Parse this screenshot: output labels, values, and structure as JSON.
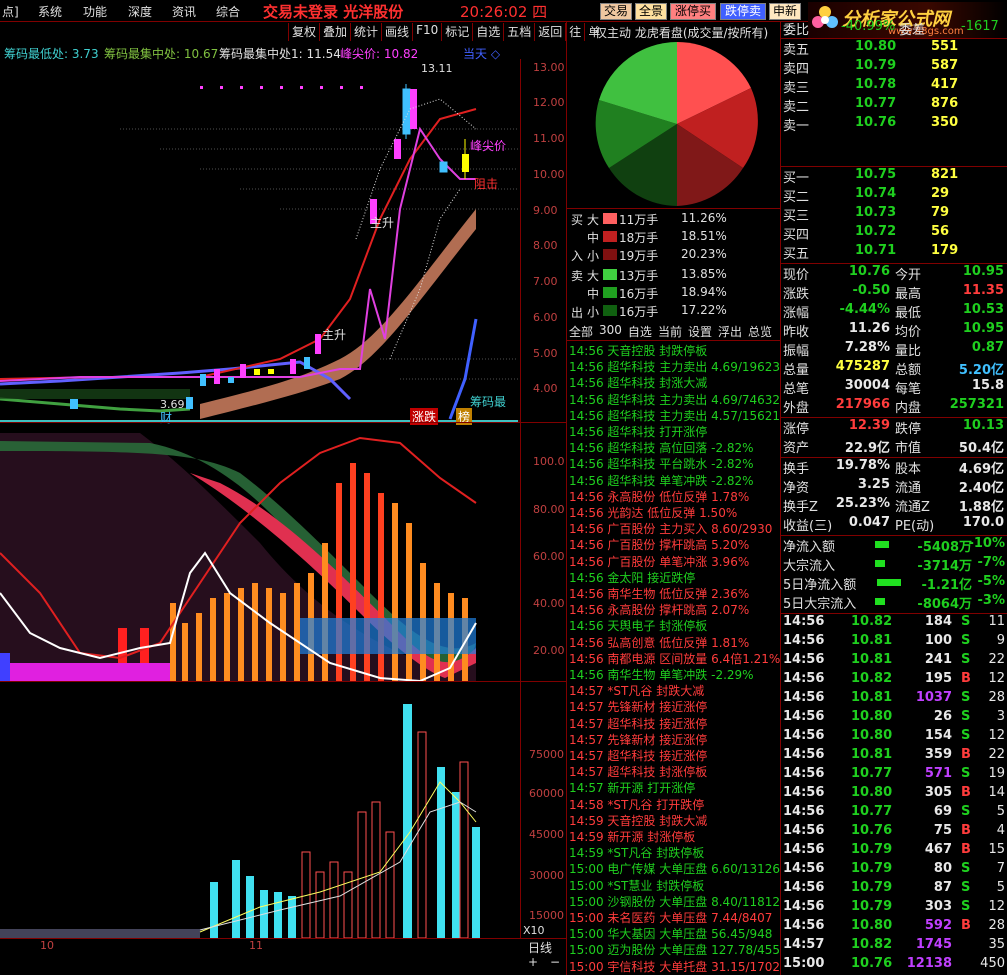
{
  "topbar": {
    "menu": [
      "点]",
      "系统",
      "功能",
      "深度",
      "资讯",
      "综合"
    ],
    "title": "交易未登录  光洋股份",
    "time": "20:26:02 四",
    "buttons": [
      "交易",
      "全景",
      "涨停买",
      "跌停卖",
      "申新"
    ],
    "brand": "分析家公式网",
    "brand_url": "www.88gs.com"
  },
  "chart_labels": {
    "chip_low": "筹码最低处: 3.73",
    "chip_mid": "筹码最集中处: 10.67",
    "chip_peak": "筹码最集中处1: 11.54",
    "peak_price": "峰尖价: 10.82",
    "today": "当天 ◇",
    "toolbar": [
      "复权",
      "叠加",
      "统计",
      "画线",
      "F10",
      "标记",
      "自选",
      "五档",
      "返回",
      "往",
      "单"
    ],
    "annot_zhusheng": "主升",
    "annot_zhusheng2": "主升",
    "annot_zuji": "阻击",
    "annot_fengjian": "峰尖价",
    "annot_chou": "筹码最",
    "annot_high": "13.11",
    "annot_low": "3.69",
    "annot_cai": "财",
    "annot_zhangdie": "涨跌",
    "annot_bang": "榜",
    "annot_x10": "X10",
    "annot_rixian": "日线",
    "annot_month10": "10",
    "annot_month11": "11",
    "plus": "+",
    "minus": "−"
  },
  "price_axis": [
    "13.00",
    "12.00",
    "11.00",
    "10.00",
    "9.00",
    "8.00",
    "7.00",
    "6.00",
    "5.00",
    "4.00"
  ],
  "osc_axis": [
    "100.0",
    "80.00",
    "60.00",
    "40.00",
    "20.00"
  ],
  "vol_axis": [
    "75000",
    "60000",
    "45000",
    "30000",
    "15000"
  ],
  "pie_header": "仅主动 龙虎看盘(成交量/按所有)",
  "flow": {
    "buy_label": [
      "买",
      "入"
    ],
    "sell_label": [
      "卖",
      "出"
    ],
    "rows": [
      {
        "side": "大",
        "vol": "11万手",
        "pct": "11.26%",
        "color": "#ff6060"
      },
      {
        "side": "中",
        "vol": "18万手",
        "pct": "18.51%",
        "color": "#c02020"
      },
      {
        "side": "小",
        "vol": "19万手",
        "pct": "20.23%",
        "color": "#801010"
      },
      {
        "side": "大",
        "vol": "13万手",
        "pct": "13.85%",
        "color": "#40d040"
      },
      {
        "side": "中",
        "vol": "16万手",
        "pct": "18.94%",
        "color": "#20a020"
      },
      {
        "side": "小",
        "vol": "16万手",
        "pct": "17.22%",
        "color": "#106010"
      }
    ],
    "tabs": [
      "全部",
      "300",
      "自选",
      "当前",
      "设置",
      "浮出",
      "总览"
    ]
  },
  "news": [
    {
      "t": "14:56",
      "n": "天音控股",
      "e": "封跌停板",
      "v": "",
      "c": "grn"
    },
    {
      "t": "14:56",
      "n": "超华科技",
      "e": "主力卖出",
      "v": "4.69/19623",
      "c": "grn"
    },
    {
      "t": "14:56",
      "n": "超华科技",
      "e": "封涨大减",
      "v": "",
      "c": "grn"
    },
    {
      "t": "14:56",
      "n": "超华科技",
      "e": "主力卖出",
      "v": "4.69/74632",
      "c": "grn"
    },
    {
      "t": "14:56",
      "n": "超华科技",
      "e": "主力卖出",
      "v": "4.57/15621",
      "c": "grn"
    },
    {
      "t": "14:56",
      "n": "超华科技",
      "e": "打开涨停",
      "v": "",
      "c": "grn"
    },
    {
      "t": "14:56",
      "n": "超华科技",
      "e": "高位回落",
      "v": "-2.82%",
      "c": "grn"
    },
    {
      "t": "14:56",
      "n": "超华科技",
      "e": "平台跳水",
      "v": "-2.82%",
      "c": "grn"
    },
    {
      "t": "14:56",
      "n": "超华科技",
      "e": "单笔冲跌",
      "v": "-2.82%",
      "c": "grn"
    },
    {
      "t": "14:56",
      "n": "永高股份",
      "e": "低位反弹",
      "v": "1.78%",
      "c": "red"
    },
    {
      "t": "14:56",
      "n": "光韵达",
      "e": "低位反弹",
      "v": "1.50%",
      "c": "red"
    },
    {
      "t": "14:56",
      "n": "广百股份",
      "e": "主力买入",
      "v": "8.60/2930",
      "c": "red"
    },
    {
      "t": "14:56",
      "n": "广百股份",
      "e": "撑杆跳高",
      "v": "5.20%",
      "c": "red"
    },
    {
      "t": "14:56",
      "n": "广百股份",
      "e": "单笔冲涨",
      "v": "3.96%",
      "c": "red"
    },
    {
      "t": "14:56",
      "n": "金太阳",
      "e": "接近跌停",
      "v": "",
      "c": "grn"
    },
    {
      "t": "14:56",
      "n": "南华生物",
      "e": "低位反弹",
      "v": "2.36%",
      "c": "red"
    },
    {
      "t": "14:56",
      "n": "永高股份",
      "e": "撑杆跳高",
      "v": "2.07%",
      "c": "red"
    },
    {
      "t": "14:56",
      "n": "天舆电子",
      "e": "封涨停板",
      "v": "",
      "c": "grn"
    },
    {
      "t": "14:56",
      "n": "弘高创意",
      "e": "低位反弹",
      "v": "1.81%",
      "c": "red"
    },
    {
      "t": "14:56",
      "n": "南都电源",
      "e": "区间放量",
      "v": "6.4倍1.21%",
      "c": "red"
    },
    {
      "t": "14:56",
      "n": "南华生物",
      "e": "单笔冲跌",
      "v": "-2.29%",
      "c": "grn"
    },
    {
      "t": "14:57",
      "n": "*ST凡谷",
      "e": "封跌大减",
      "v": "",
      "c": "red"
    },
    {
      "t": "14:57",
      "n": "先锋新材",
      "e": "接近涨停",
      "v": "",
      "c": "red"
    },
    {
      "t": "14:57",
      "n": "超华科技",
      "e": "接近涨停",
      "v": "",
      "c": "red"
    },
    {
      "t": "14:57",
      "n": "先锋新材",
      "e": "接近涨停",
      "v": "",
      "c": "red"
    },
    {
      "t": "14:57",
      "n": "超华科技",
      "e": "接近涨停",
      "v": "",
      "c": "red"
    },
    {
      "t": "14:57",
      "n": "超华科技",
      "e": "封涨停板",
      "v": "",
      "c": "red"
    },
    {
      "t": "14:57",
      "n": "新开源",
      "e": "打开涨停",
      "v": "",
      "c": "grn"
    },
    {
      "t": "14:58",
      "n": "*ST凡谷",
      "e": "打开跌停",
      "v": "",
      "c": "red"
    },
    {
      "t": "14:59",
      "n": "天音控股",
      "e": "封跌大减",
      "v": "",
      "c": "red"
    },
    {
      "t": "14:59",
      "n": "新开源",
      "e": "封涨停板",
      "v": "",
      "c": "red"
    },
    {
      "t": "14:59",
      "n": "*ST凡谷",
      "e": "封跌停板",
      "v": "",
      "c": "grn"
    },
    {
      "t": "15:00",
      "n": "电广传媒",
      "e": "大单压盘",
      "v": "6.60/13126",
      "c": "grn"
    },
    {
      "t": "15:00",
      "n": "*ST慧业",
      "e": "封跌停板",
      "v": "",
      "c": "grn"
    },
    {
      "t": "15:00",
      "n": "沙钢股份",
      "e": "大单压盘",
      "v": "8.40/11812",
      "c": "grn"
    },
    {
      "t": "15:00",
      "n": "未名医药",
      "e": "大单压盘",
      "v": "7.44/8407",
      "c": "red"
    },
    {
      "t": "15:00",
      "n": "华大基因",
      "e": "大单压盘",
      "v": "56.45/948",
      "c": "grn"
    },
    {
      "t": "15:00",
      "n": "迈为股份",
      "e": "大单压盘",
      "v": "127.78/455",
      "c": "grn"
    },
    {
      "t": "15:00",
      "n": "宇信科技",
      "e": "大单托盘",
      "v": "31.15/1702",
      "c": "red"
    }
  ],
  "quote": {
    "webi_label": "委比",
    "webi_val": "-40.99%",
    "weicha_label": "委差",
    "weicha_val": "-1617",
    "asks": [
      {
        "l": "卖五",
        "p": "10.80",
        "v": "551",
        "c": "grn"
      },
      {
        "l": "卖四",
        "p": "10.79",
        "v": "587",
        "c": "grn"
      },
      {
        "l": "卖三",
        "p": "10.78",
        "v": "417",
        "c": "grn"
      },
      {
        "l": "卖二",
        "p": "10.77",
        "v": "876",
        "c": "grn"
      },
      {
        "l": "卖一",
        "p": "10.76",
        "v": "350",
        "c": "grn"
      }
    ],
    "bids": [
      {
        "l": "买一",
        "p": "10.75",
        "v": "821",
        "c": "grn"
      },
      {
        "l": "买二",
        "p": "10.74",
        "v": "29",
        "c": "grn"
      },
      {
        "l": "买三",
        "p": "10.73",
        "v": "79",
        "c": "grn"
      },
      {
        "l": "买四",
        "p": "10.72",
        "v": "56",
        "c": "grn"
      },
      {
        "l": "买五",
        "p": "10.71",
        "v": "179",
        "c": "grn"
      }
    ],
    "stats": [
      {
        "l1": "现价",
        "v1": "10.76",
        "c1": "grn",
        "l2": "今开",
        "v2": "10.95",
        "c2": "grn"
      },
      {
        "l1": "涨跌",
        "v1": "-0.50",
        "c1": "grn",
        "l2": "最高",
        "v2": "11.35",
        "c2": "red"
      },
      {
        "l1": "涨幅",
        "v1": "-4.44%",
        "c1": "grn",
        "l2": "最低",
        "v2": "10.53",
        "c2": "grn"
      },
      {
        "l1": "昨收",
        "v1": "11.26",
        "c1": "wht",
        "l2": "均价",
        "v2": "10.95",
        "c2": "grn"
      },
      {
        "l1": "振幅",
        "v1": "7.28%",
        "c1": "wht",
        "l2": "量比",
        "v2": "0.87",
        "c2": "grn"
      },
      {
        "l1": "总量",
        "v1": "475287",
        "c1": "ylw",
        "l2": "总额",
        "v2": "5.20亿",
        "c2": "ylwc"
      },
      {
        "l1": "总笔",
        "v1": "30004",
        "c1": "wht",
        "l2": "每笔",
        "v2": "15.8",
        "c2": "wht"
      },
      {
        "l1": "外盘",
        "v1": "217966",
        "c1": "red",
        "l2": "内盘",
        "v2": "257321",
        "c2": "grn"
      }
    ],
    "stats2": [
      {
        "l1": "涨停",
        "v1": "12.39",
        "c1": "red",
        "l2": "跌停",
        "v2": "10.13",
        "c2": "grn"
      },
      {
        "l1": "资产",
        "v1": "22.9亿",
        "c1": "wht",
        "l2": "市值",
        "v2": "50.4亿",
        "c2": "wht"
      }
    ],
    "stats3": [
      {
        "l1": "换手",
        "v1": "19.78%",
        "c1": "wht",
        "l2": "股本",
        "v2": "4.69亿",
        "c2": "wht"
      },
      {
        "l1": "净资",
        "v1": "3.25",
        "c1": "wht",
        "l2": "流通",
        "v2": "2.40亿",
        "c2": "wht"
      },
      {
        "l1": "换手Z",
        "v1": "25.23%",
        "c1": "wht",
        "l2": "流通Z",
        "v2": "1.88亿",
        "c2": "wht"
      },
      {
        "l1": "收益(三)",
        "v1": "0.047",
        "c1": "wht",
        "l2": "PE(动)",
        "v2": "170.0",
        "c2": "wht"
      }
    ],
    "flows": [
      {
        "l": "净流入额",
        "v": "-5408万",
        "p": "-10%"
      },
      {
        "l": "大宗流入",
        "v": "-3714万",
        "p": "-7%"
      },
      {
        "l": "5日净流入额",
        "v": "-1.21亿",
        "p": "-5%"
      },
      {
        "l": "5日大宗流入",
        "v": "-8064万",
        "p": "-3%"
      }
    ],
    "ticks": [
      {
        "t": "14:56",
        "p": "10.82",
        "v": "184",
        "d": "S",
        "n": "11",
        "pc": "grn",
        "vc": "wht",
        "dc": "grn"
      },
      {
        "t": "14:56",
        "p": "10.81",
        "v": "100",
        "d": "S",
        "n": "9",
        "pc": "grn",
        "vc": "wht",
        "dc": "grn"
      },
      {
        "t": "14:56",
        "p": "10.81",
        "v": "241",
        "d": "S",
        "n": "22",
        "pc": "grn",
        "vc": "wht",
        "dc": "grn"
      },
      {
        "t": "14:56",
        "p": "10.82",
        "v": "195",
        "d": "B",
        "n": "12",
        "pc": "grn",
        "vc": "wht",
        "dc": "red"
      },
      {
        "t": "14:56",
        "p": "10.81",
        "v": "1037",
        "d": "S",
        "n": "28",
        "pc": "grn",
        "vc": "mag",
        "dc": "grn"
      },
      {
        "t": "14:56",
        "p": "10.80",
        "v": "26",
        "d": "S",
        "n": "3",
        "pc": "grn",
        "vc": "wht",
        "dc": "grn"
      },
      {
        "t": "14:56",
        "p": "10.80",
        "v": "154",
        "d": "S",
        "n": "12",
        "pc": "grn",
        "vc": "wht",
        "dc": "grn"
      },
      {
        "t": "14:56",
        "p": "10.81",
        "v": "359",
        "d": "B",
        "n": "22",
        "pc": "grn",
        "vc": "wht",
        "dc": "red"
      },
      {
        "t": "14:56",
        "p": "10.77",
        "v": "571",
        "d": "S",
        "n": "19",
        "pc": "grn",
        "vc": "mag",
        "dc": "grn"
      },
      {
        "t": "14:56",
        "p": "10.80",
        "v": "305",
        "d": "B",
        "n": "14",
        "pc": "grn",
        "vc": "wht",
        "dc": "red"
      },
      {
        "t": "14:56",
        "p": "10.77",
        "v": "69",
        "d": "S",
        "n": "5",
        "pc": "grn",
        "vc": "wht",
        "dc": "grn"
      },
      {
        "t": "14:56",
        "p": "10.76",
        "v": "75",
        "d": "B",
        "n": "4",
        "pc": "grn",
        "vc": "wht",
        "dc": "red"
      },
      {
        "t": "14:56",
        "p": "10.79",
        "v": "467",
        "d": "B",
        "n": "15",
        "pc": "grn",
        "vc": "wht",
        "dc": "red"
      },
      {
        "t": "14:56",
        "p": "10.79",
        "v": "80",
        "d": "S",
        "n": "7",
        "pc": "grn",
        "vc": "wht",
        "dc": "grn"
      },
      {
        "t": "14:56",
        "p": "10.79",
        "v": "87",
        "d": "S",
        "n": "5",
        "pc": "grn",
        "vc": "wht",
        "dc": "grn"
      },
      {
        "t": "14:56",
        "p": "10.79",
        "v": "303",
        "d": "S",
        "n": "12",
        "pc": "grn",
        "vc": "wht",
        "dc": "grn"
      },
      {
        "t": "14:56",
        "p": "10.80",
        "v": "592",
        "d": "B",
        "n": "28",
        "pc": "grn",
        "vc": "mag",
        "dc": "red"
      },
      {
        "t": "14:57",
        "p": "10.82",
        "v": "1745",
        "d": "",
        "n": "35",
        "pc": "grn",
        "vc": "mag",
        "dc": "grn"
      },
      {
        "t": "15:00",
        "p": "10.76",
        "v": "12138",
        "d": "",
        "n": "450",
        "pc": "grn",
        "vc": "mag",
        "dc": "grn"
      }
    ]
  },
  "colors": {
    "bg": "#000000",
    "border": "#800000",
    "red": "#ff3c3c",
    "green": "#1fcf1f",
    "yellow": "#ffff40",
    "cyan": "#40e0e0"
  }
}
